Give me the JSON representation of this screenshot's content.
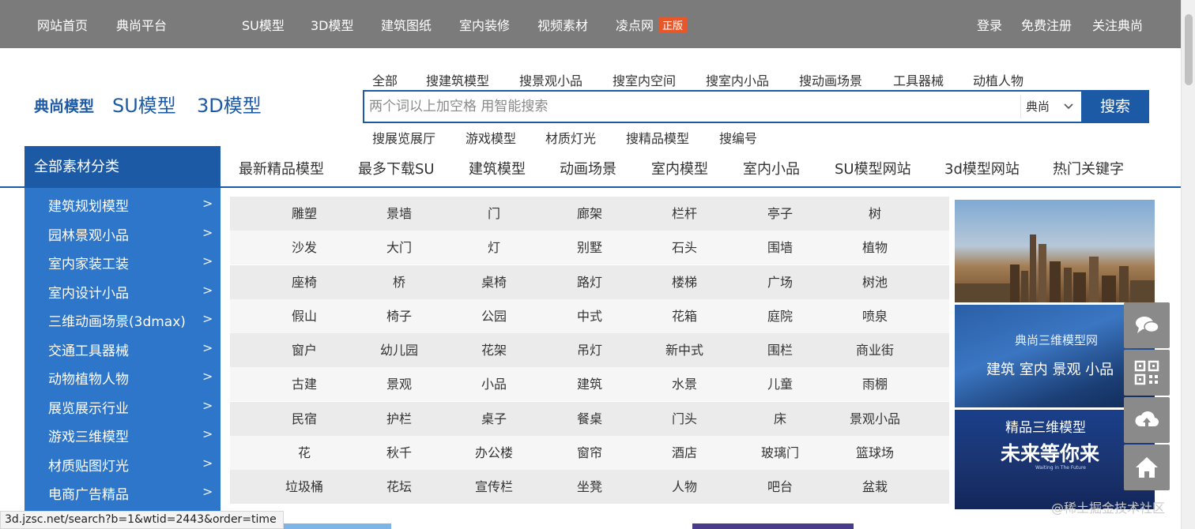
{
  "topbar": {
    "left": [
      "网站首页",
      "典尚平台"
    ],
    "center": [
      "SU模型",
      "3D模型",
      "建筑图纸",
      "室内装修",
      "视频素材"
    ],
    "lingdian": "凌点网",
    "lingdian_badge": "正版",
    "right": [
      "登录",
      "免费注册",
      "关注典尚"
    ]
  },
  "brand": {
    "small": "典尚模型",
    "su": "SU模型",
    "threed": "3D模型"
  },
  "search": {
    "tabs": [
      "全部",
      "搜建筑模型",
      "搜景观小品",
      "搜室内空间",
      "搜室内小品",
      "搜动画场景",
      "工具器械",
      "动植人物"
    ],
    "placeholder": "两个词以上加空格 用智能搜索",
    "scope": "典尚",
    "button": "搜索",
    "sub_tabs": [
      "搜展览展厅",
      "游戏模型",
      "材质灯光",
      "搜精品模型",
      "搜编号"
    ]
  },
  "nav": {
    "all_label": "全部素材分类",
    "links": [
      "最新精品模型",
      "最多下载SU",
      "建筑模型",
      "动画场景",
      "室内模型",
      "室内小品",
      "SU模型网站",
      "3d模型网站",
      "热门关键字"
    ]
  },
  "sidebar": {
    "items": [
      "建筑规划模型",
      "园林景观小品",
      "室内家装工装",
      "室内设计小品",
      "三维动画场景(3dmax)",
      "交通工具器械",
      "动物植物人物",
      "展览展示行业",
      "游戏三维模型",
      "材质贴图灯光",
      "电商广告精品"
    ],
    "chevron": ">"
  },
  "keywords": [
    [
      "雕塑",
      "景墙",
      "门",
      "廊架",
      "栏杆",
      "亭子",
      "树"
    ],
    [
      "沙发",
      "大门",
      "灯",
      "别墅",
      "石头",
      "围墙",
      "植物"
    ],
    [
      "座椅",
      "桥",
      "桌椅",
      "路灯",
      "楼梯",
      "广场",
      "树池"
    ],
    [
      "假山",
      "椅子",
      "公园",
      "中式",
      "花箱",
      "庭院",
      "喷泉"
    ],
    [
      "窗户",
      "幼儿园",
      "花架",
      "吊灯",
      "新中式",
      "围栏",
      "商业街"
    ],
    [
      "古建",
      "景观",
      "小品",
      "建筑",
      "水景",
      "儿童",
      "雨棚"
    ],
    [
      "民宿",
      "护栏",
      "桌子",
      "餐桌",
      "门头",
      "床",
      "景观小品"
    ],
    [
      "花",
      "秋千",
      "办公楼",
      "窗帘",
      "酒店",
      "玻璃门",
      "篮球场"
    ],
    [
      "垃圾桶",
      "花坛",
      "宣传栏",
      "坐凳",
      "人物",
      "吧台",
      "盆栽"
    ]
  ],
  "banners": {
    "b2_title": "典尚三维模型网",
    "b2_sub": "建筑 室内 景观 小品",
    "b3_title": "精品三维模型",
    "b3_main": "未来等你来",
    "b3_small": "Waiting in The Future"
  },
  "float_tools": [
    "chat-icon",
    "qrcode-icon",
    "cloud-upload-icon",
    "home-icon"
  ],
  "status_url": "3d.jzsc.net/search?b=1&wtid=2443&order=time",
  "watermark": "@稀土掘金技术社区",
  "colors": {
    "topbar": "#7b7b7b",
    "brand_blue": "#1d5aa6",
    "sidebar_blue": "#2d76c9",
    "badge": "#e8572a"
  }
}
